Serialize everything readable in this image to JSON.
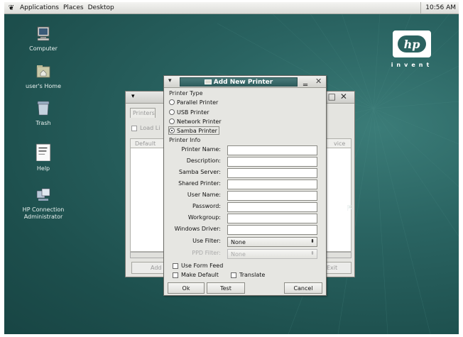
{
  "panel": {
    "menus": [
      "Applications",
      "Places",
      "Desktop"
    ],
    "clock": "10:56 AM"
  },
  "desktop_icons": [
    {
      "label": "Computer",
      "icon": "computer-icon"
    },
    {
      "label": "user's Home",
      "icon": "home-folder-icon"
    },
    {
      "label": "Trash",
      "icon": "trash-icon"
    },
    {
      "label": "Help",
      "icon": "help-icon"
    },
    {
      "label": "HP Connection Administrator",
      "icon": "hp-connection-icon"
    }
  ],
  "hp_logo": {
    "mark": "hp",
    "tagline": "invent"
  },
  "background_window": {
    "tab": "Printers",
    "load_label": "Load Li",
    "column_default": "Default",
    "column_device": "vice",
    "add_button": "Add",
    "exit_button": "Exit"
  },
  "dialog": {
    "title": "Add New Printer",
    "printer_type_label": "Printer Type",
    "printer_types": [
      {
        "label": "Parallel Printer",
        "selected": false
      },
      {
        "label": "USB Printer",
        "selected": false
      },
      {
        "label": "Network Printer",
        "selected": false
      },
      {
        "label": "Samba Printer",
        "selected": true
      }
    ],
    "printer_info_label": "Printer Info",
    "fields": [
      {
        "label": "Printer Name:",
        "value": ""
      },
      {
        "label": "Description:",
        "value": ""
      },
      {
        "label": "Samba Server:",
        "value": ""
      },
      {
        "label": "Shared Printer:",
        "value": ""
      },
      {
        "label": "User Name:",
        "value": ""
      },
      {
        "label": "Password:",
        "value": ""
      },
      {
        "label": "Workgroup:",
        "value": ""
      },
      {
        "label": "Windows Driver:",
        "value": ""
      }
    ],
    "use_filter_label": "Use Filter:",
    "use_filter_value": "None",
    "ppd_filter_label": "PPD Filter:",
    "ppd_filter_value": "None",
    "use_form_feed": "Use Form Feed",
    "make_default": "Make Default",
    "translate": "Translate",
    "ok": "Ok",
    "test": "Test",
    "cancel": "Cancel"
  }
}
